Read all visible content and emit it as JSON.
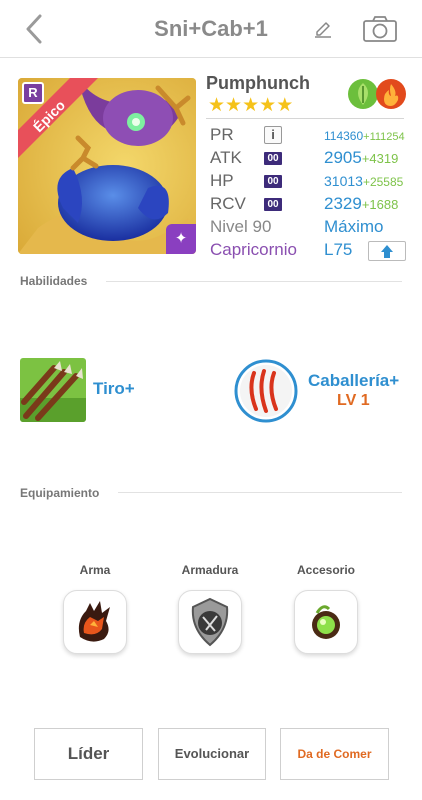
{
  "header": {
    "title": "Sni+Cab+1",
    "back_icon": "chevron-left-icon",
    "edit_icon": "pencil-icon",
    "camera_icon": "camera-icon"
  },
  "monster": {
    "name": "Pumphunch",
    "rarity": "Épico",
    "rank_badge": "R",
    "stars": 5,
    "elements": [
      "nature",
      "fire"
    ],
    "stats": {
      "pr": {
        "label": "PR",
        "value": "114360",
        "bonus": "+111254"
      },
      "atk": {
        "label": "ATK",
        "value": "2905",
        "bonus": "+4319"
      },
      "hp": {
        "label": "HP",
        "value": "31013",
        "bonus": "+25585"
      },
      "rcv": {
        "label": "RCV",
        "value": "2329",
        "bonus": "+1688"
      }
    },
    "stat_badge": "00",
    "info_badge": "i",
    "level_label": "Nivel 90",
    "level_value": "Máximo",
    "constellation": "Capricornio",
    "constellation_level": "L75"
  },
  "skills_section": {
    "title": "Habilidades",
    "skills": [
      {
        "name": "Tiro+",
        "icon": "arrows-icon"
      },
      {
        "name": "Caballería+",
        "level": "LV 1",
        "icon": "claw-marks-icon"
      }
    ]
  },
  "equipment_section": {
    "title": "Equipamiento",
    "slots": [
      {
        "label": "Arma",
        "icon": "lava-claw-icon"
      },
      {
        "label": "Armadura",
        "icon": "stone-armor-icon"
      },
      {
        "label": "Accesorio",
        "icon": "green-orb-icon"
      }
    ]
  },
  "actions": {
    "leader": "Líder",
    "evolve": "Evolucionar",
    "feed": "Da de Comer"
  },
  "colors": {
    "accent_blue": "#2f8fd0",
    "bonus_green": "#7ec34a",
    "star_gold": "#f5c21a",
    "orange": "#e06a22",
    "purple": "#8a4fb0"
  }
}
